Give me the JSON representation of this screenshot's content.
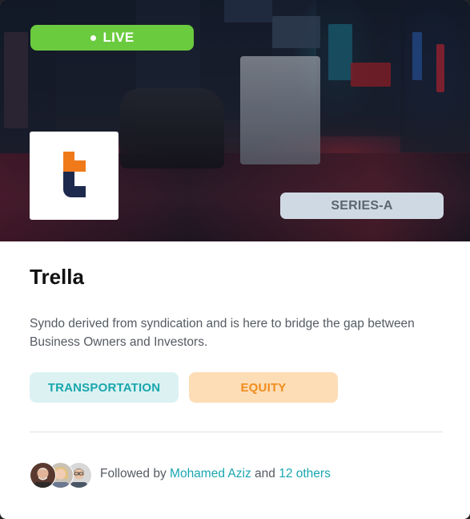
{
  "hero": {
    "status_badge": "LIVE",
    "round_badge": "SERIES-A"
  },
  "company": {
    "name": "Trella",
    "description": "Syndo derived from syndication and is here to bridge the gap between Business Owners and Investors.",
    "logo_icon": "trella-t-logo",
    "logo_colors": {
      "orange": "#f07a1a",
      "navy": "#1d2a4d"
    }
  },
  "tags": [
    {
      "label": "TRANSPORTATION",
      "bg": "#dcf1f2",
      "color": "#18a7ad"
    },
    {
      "label": "EQUITY",
      "bg": "#fdddb6",
      "color": "#f08c1c"
    }
  ],
  "followers": {
    "prefix": "Followed by",
    "name": "Mohamed Aziz",
    "joiner": "and",
    "others": "12 others",
    "avatars": [
      "avatar-older-man",
      "avatar-blonde-woman",
      "avatar-man-glasses"
    ]
  },
  "colors": {
    "live_green": "#6bcb3f",
    "series_bg": "#cfd9e3",
    "link_teal": "#19a6b0"
  }
}
